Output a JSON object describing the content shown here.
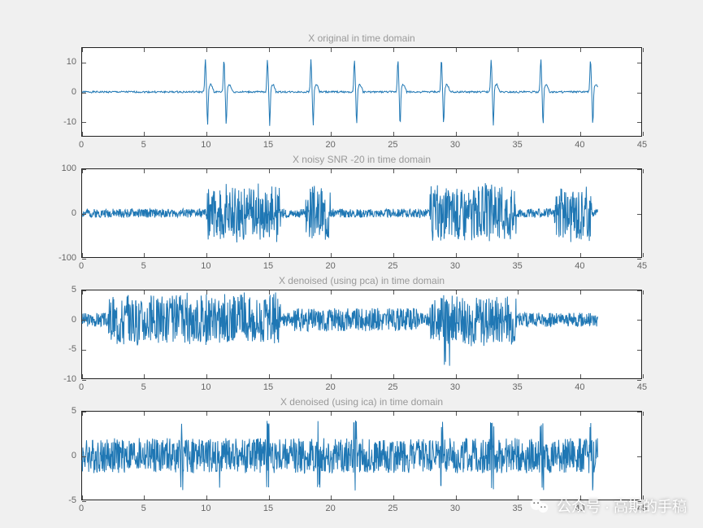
{
  "watermark": {
    "label": "公众号 · 高斯的手稿"
  },
  "chart_data": [
    {
      "type": "line",
      "title": "X original in time domain",
      "xlabel": "",
      "ylabel": "",
      "xlim": [
        0,
        45
      ],
      "ylim": [
        -15,
        15
      ],
      "xticks": [
        0,
        5,
        10,
        15,
        20,
        25,
        30,
        35,
        40,
        45
      ],
      "yticks": [
        -10,
        0,
        10
      ],
      "signal_description": "Clean biomedical-style waveform (ECG-like) with ~9 sharp spike complexes near x≈10,11.5,15,18.5,22,25.5,29,33,37,41 on a near-zero baseline; each spike reaches approximately +10 upward and a sharp negative ~-12 downward notch.",
      "spike_positions_x": [
        10,
        11.5,
        15,
        18.5,
        22,
        25.5,
        29,
        33,
        37,
        41
      ],
      "spike_amplitude_pos": 11,
      "spike_amplitude_neg": -12,
      "baseline": 0
    },
    {
      "type": "line",
      "title": "X noisy SNR -20  in time domain",
      "xlabel": "",
      "ylabel": "",
      "xlim": [
        0,
        45
      ],
      "ylim": [
        -100,
        100
      ],
      "xticks": [
        0,
        5,
        10,
        15,
        20,
        25,
        30,
        35,
        40,
        45
      ],
      "yticks": [
        -100,
        0,
        100
      ],
      "signal_description": "Heavily contaminated version: dense noise bursts with large amplitude (~±60–80) concentrated around x≈10–16, 18–20, 28–35, 38–41; quieter (~±10) elsewhere.",
      "burst_intervals_x": [
        [
          10,
          16
        ],
        [
          18,
          20
        ],
        [
          28,
          35
        ],
        [
          38,
          41
        ]
      ],
      "burst_amplitude": 70,
      "quiet_amplitude": 10
    },
    {
      "type": "line",
      "title": "X denoised (using pca) in time domain",
      "xlabel": "",
      "ylabel": "",
      "xlim": [
        0,
        45
      ],
      "ylim": [
        -10,
        5
      ],
      "xticks": [
        0,
        5,
        10,
        15,
        20,
        25,
        30,
        35,
        40,
        45
      ],
      "yticks": [
        -10,
        -5,
        0,
        5
      ],
      "signal_description": "PCA-denoised output; residual noise envelope similar to noisy signal pattern but scaled to roughly ±4. Dense activity across x≈2–16, moderate 17–27, dense 28–35, sparse after 36.",
      "burst_intervals_x": [
        [
          2,
          16
        ],
        [
          28,
          35
        ]
      ],
      "burst_amplitude": 4.5,
      "quiet_amplitude": 1.2
    },
    {
      "type": "line",
      "title": "X denoised (using ica) in time domain",
      "xlabel": "",
      "ylabel": "",
      "xlim": [
        0,
        45
      ],
      "ylim": [
        -5,
        5
      ],
      "xticks": [
        0,
        5,
        10,
        15,
        20,
        25,
        30,
        35,
        40,
        45
      ],
      "yticks": [
        -5,
        0,
        5
      ],
      "signal_description": "ICA-denoised output; relatively uniform noise of amplitude ~±2 across full range with occasional spikes to ~±4 near x≈8,11,15,19,22,29,33,37,41 (echoing original spike locations).",
      "uniform_amplitude": 2.0,
      "residual_spikes_x": [
        8,
        11,
        15,
        19,
        22,
        29,
        33,
        37,
        41
      ],
      "residual_spike_amplitude": 4
    }
  ]
}
